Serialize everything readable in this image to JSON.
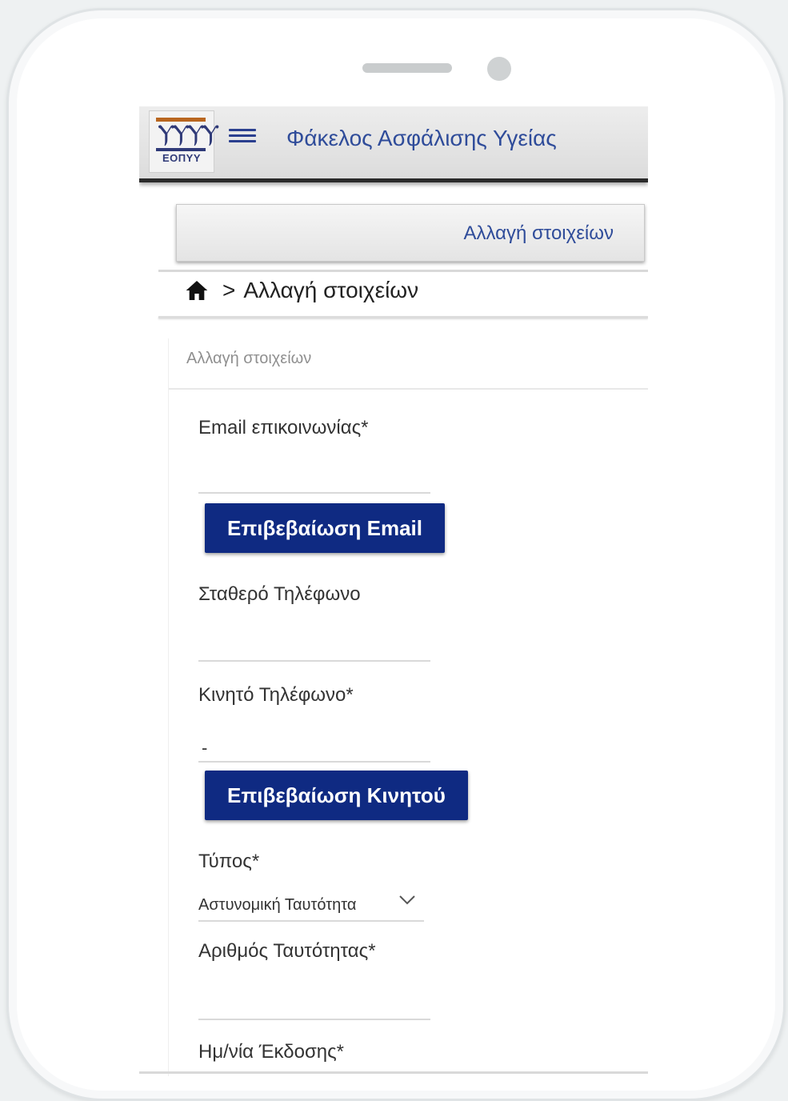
{
  "app": {
    "logo_text": "ΕΟΠΥΥ",
    "title": "Φάκελος Ασφάλισης Υγείας"
  },
  "tab": {
    "label": "Αλλαγή στοιχείων"
  },
  "breadcrumb": {
    "separator": ">",
    "current": "Αλλαγή στοιχείων"
  },
  "card": {
    "header": "Αλλαγή στοιχείων"
  },
  "form": {
    "email_label": "Email επικοινωνίας*",
    "email_value": "",
    "confirm_email_label": "Επιβεβαίωση Email",
    "landline_label": "Σταθερό Τηλέφωνο",
    "landline_value": "",
    "mobile_label": "Κινητό Τηλέφωνο*",
    "mobile_value": "-",
    "confirm_mobile_label": "Επιβεβαίωση Κινητού",
    "type_label": "Τύπος*",
    "type_value": "Αστυνομική Ταυτότητα",
    "id_number_label": "Αριθμός Ταυτότητας*",
    "id_number_value": "",
    "issue_date_label": "Ημ/νία Έκδοσης*"
  },
  "colors": {
    "primary_button": "#0f2a82",
    "title_text": "#2f4c9a",
    "logo_accent": "#b9661f"
  },
  "icons": {
    "menu": "hamburger-menu-icon",
    "home": "home-icon",
    "dropdown": "chevron-down-icon"
  }
}
